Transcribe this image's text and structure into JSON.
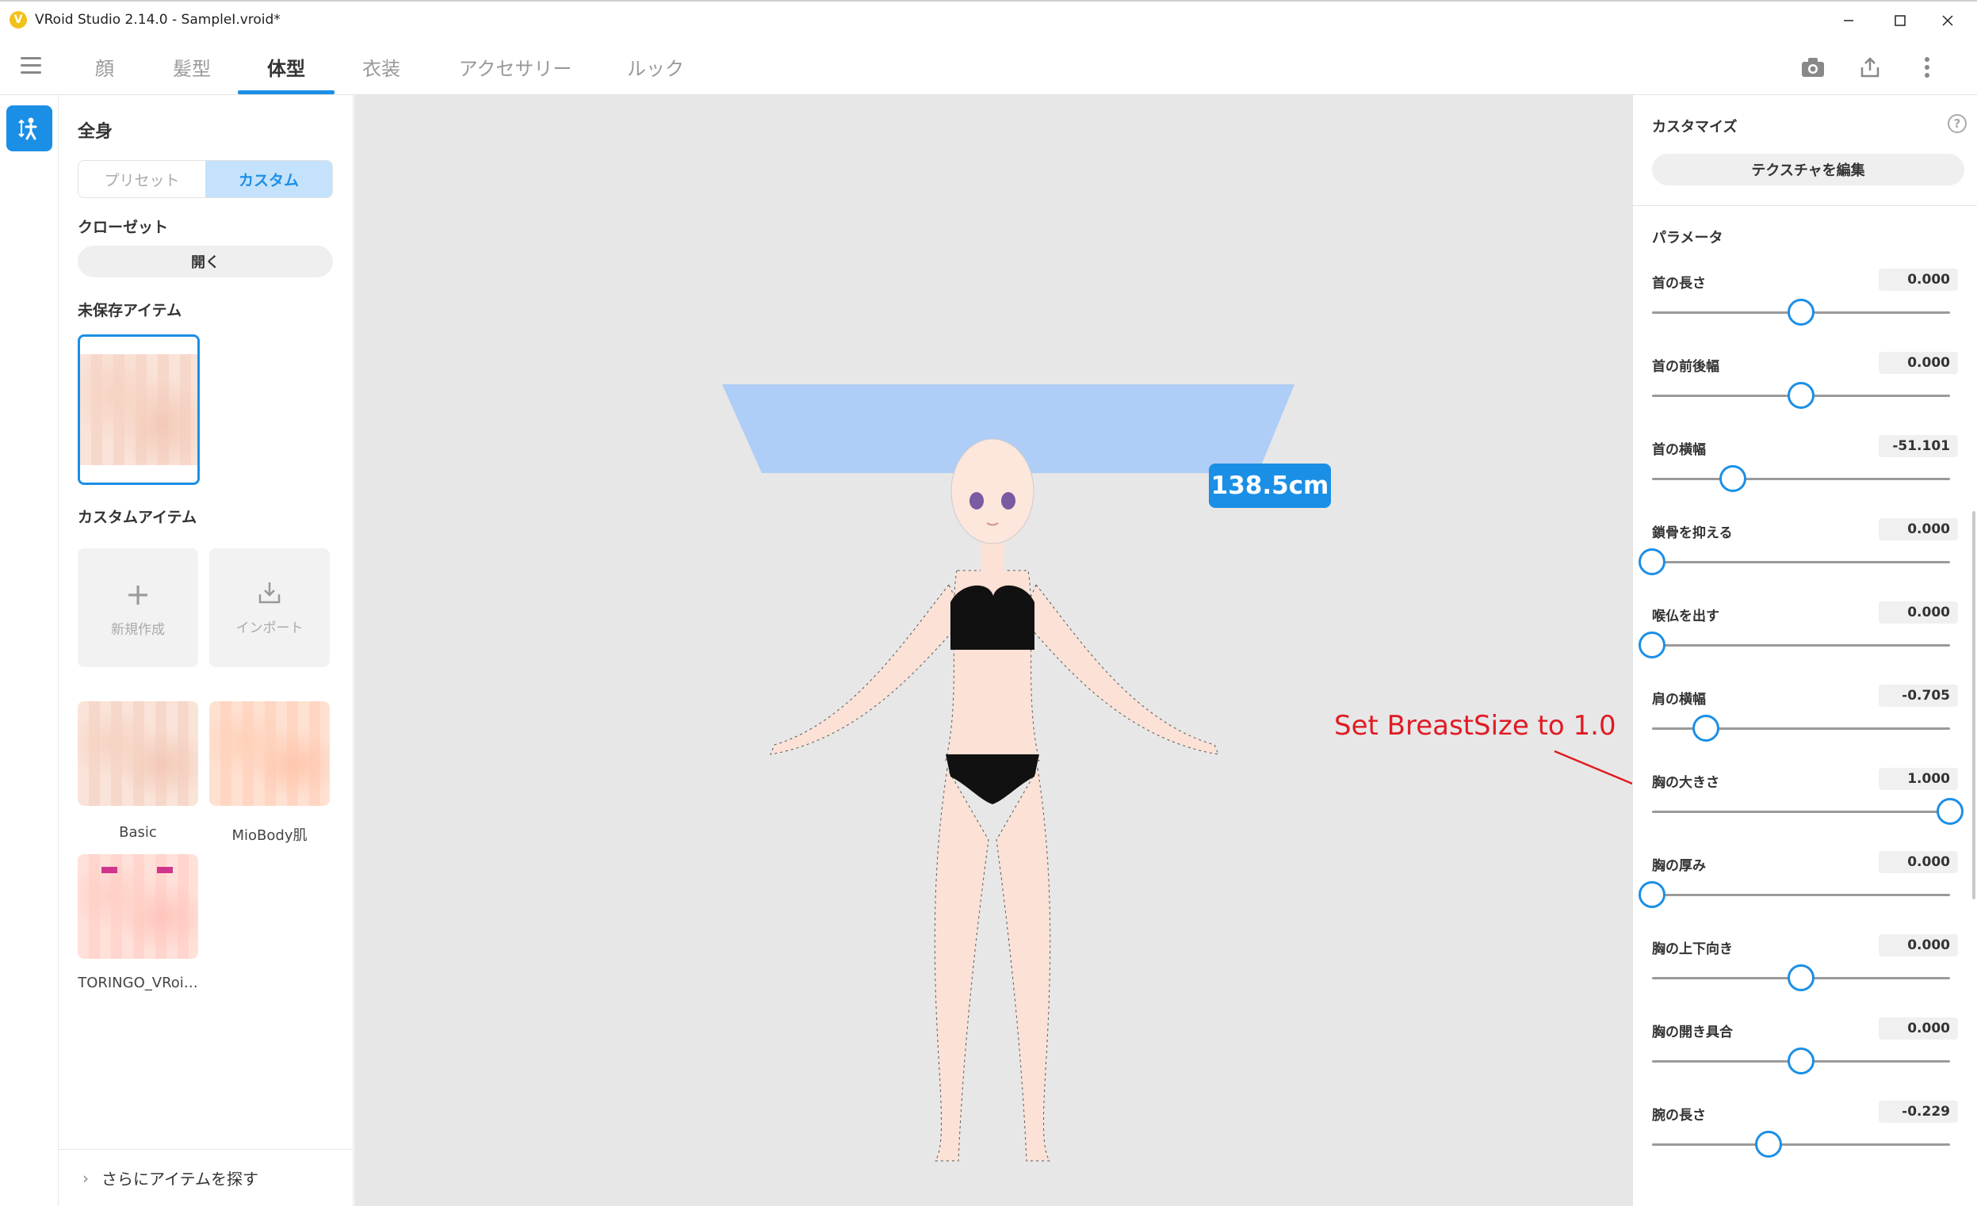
{
  "window": {
    "title": "VRoid Studio 2.14.0 - SampleI.vroid*",
    "controls": [
      "minimize",
      "maximize",
      "close"
    ]
  },
  "tabs": [
    {
      "label": "顔",
      "active": false
    },
    {
      "label": "髪型",
      "active": false
    },
    {
      "label": "体型",
      "active": true
    },
    {
      "label": "衣装",
      "active": false
    },
    {
      "label": "アクセサリー",
      "active": false
    },
    {
      "label": "ルック",
      "active": false
    }
  ],
  "toolbar_icons": [
    "camera-icon",
    "export-icon",
    "more-vertical-icon"
  ],
  "left_panel": {
    "title": "全身",
    "segment": {
      "preset": "プリセット",
      "custom": "カスタム",
      "selected": "custom"
    },
    "closet_label": "クローゼット",
    "closet_button": "開く",
    "unsaved_label": "未保存アイテム",
    "custom_label": "カスタムアイテム",
    "new_label": "新規作成",
    "import_label": "インポート",
    "items": [
      "Basic",
      "MioBody肌",
      "TORINGO_VRoi…"
    ],
    "footer": "さらにアイテムを探す"
  },
  "viewport": {
    "height_badge": "138.5cm",
    "annotation": "Set BreastSize to 1.0",
    "annotation_color": "#e01b24"
  },
  "right_panel": {
    "customize_label": "カスタマイズ",
    "texture_button": "テクスチャを編集",
    "params_label": "パラメータ",
    "params": [
      {
        "name": "首の長さ",
        "value": "0.000",
        "level": 0.5
      },
      {
        "name": "首の前後幅",
        "value": "0.000",
        "level": 0.5
      },
      {
        "name": "首の横幅",
        "value": "-51.101",
        "level": 0.27
      },
      {
        "name": "鎖骨を抑える",
        "value": "0.000",
        "level": 0.0
      },
      {
        "name": "喉仏を出す",
        "value": "0.000",
        "level": 0.0
      },
      {
        "name": "肩の横幅",
        "value": "-0.705",
        "level": 0.18
      },
      {
        "name": "胸の大きさ",
        "value": "1.000",
        "level": 1.0
      },
      {
        "name": "胸の厚み",
        "value": "0.000",
        "level": 0.0
      },
      {
        "name": "胸の上下向き",
        "value": "0.000",
        "level": 0.5
      },
      {
        "name": "胸の開き具合",
        "value": "0.000",
        "level": 0.5
      },
      {
        "name": "腕の長さ",
        "value": "-0.229",
        "level": 0.39
      }
    ]
  },
  "colors": {
    "accent": "#1b8fe6",
    "segment_on": "#c4e2fb",
    "viewport_bg": "#e7e7e7"
  }
}
